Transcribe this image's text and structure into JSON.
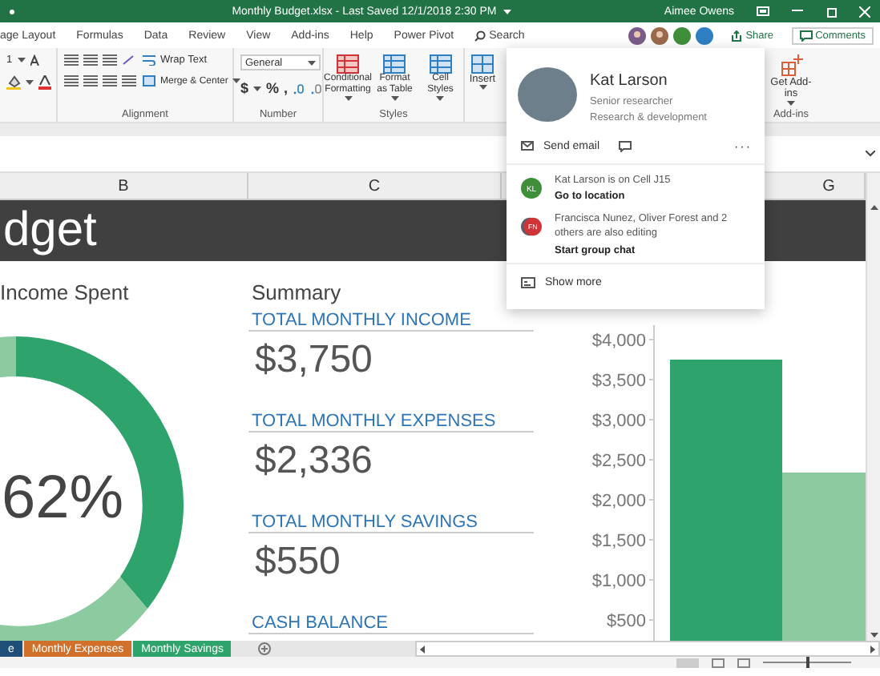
{
  "title_bar": {
    "title": "Monthly Budget.xlsx - Last Saved 12/1/2018 2:30 PM",
    "user": "Aimee Owens"
  },
  "ribbon_tabs": [
    "age Layout",
    "Formulas",
    "Data",
    "Review",
    "View",
    "Add-ins",
    "Help",
    "Power Pivot"
  ],
  "search": {
    "label": "Search"
  },
  "collaborators": [
    {
      "kind": "photo",
      "color": "#7a5c8a"
    },
    {
      "kind": "photo",
      "color": "#9a6a4a"
    },
    {
      "kind": "initials",
      "color": "#3f8f3a"
    },
    {
      "kind": "initials",
      "color": "#2f7fc4"
    }
  ],
  "share": "Share",
  "comments": "Comments",
  "ribbon": {
    "font_size": "1",
    "alignment": {
      "wrap_text": "Wrap Text",
      "merge_center": "Merge & Center",
      "label": "Alignment"
    },
    "number": {
      "format": "General",
      "currency": "$",
      "percent": "%",
      "comma": ",",
      "label": "Number"
    },
    "styles": {
      "buttons": [
        "Conditional Formatting",
        "Format as Table",
        "Cell Styles"
      ],
      "label": "Styles"
    },
    "cells": {
      "buttons": [
        "Insert"
      ]
    },
    "add_ins": {
      "button": "Get Add-ins",
      "label": "Add-ins"
    }
  },
  "column_headers": [
    {
      "label": "B"
    },
    {
      "label": "C"
    },
    {
      "label": "G"
    }
  ],
  "sheet": {
    "banner": "dget",
    "income_title": "Income Spent",
    "donut_label": "62%",
    "summary": {
      "title": "Summary",
      "items": [
        {
          "label": "TOTAL MONTHLY INCOME",
          "value": "$3,750"
        },
        {
          "label": "TOTAL MONTHLY EXPENSES",
          "value": "$2,336"
        },
        {
          "label": "TOTAL MONTHLY SAVINGS",
          "value": "$550"
        },
        {
          "label": "CASH BALANCE"
        }
      ]
    },
    "chart_axis_labels": [
      "$4,000",
      "$3,500",
      "$3,000",
      "$2,500",
      "$2,000",
      "$1,500",
      "$1,000",
      "$500"
    ]
  },
  "contact_card": {
    "name": "Kat Larson",
    "title": "Senior researcher",
    "department": "Research & development",
    "send_email": "Send email",
    "more": "···",
    "activity": [
      {
        "kind": "single",
        "initials": "KL",
        "color": "#3f8f3a",
        "text": "Kat Larson is on Cell J15",
        "action": "Go to location"
      },
      {
        "kind": "group",
        "initials": "FN",
        "color": "#d13438",
        "text": "Francisca Nunez, Oliver Forest and 2 others are also editing",
        "action": "Start group chat"
      }
    ],
    "show_more": "Show more"
  },
  "sheet_tabs": [
    {
      "label": "e",
      "color": "#1f4e79"
    },
    {
      "label": "Monthly Expenses",
      "color": "#d0702a"
    },
    {
      "label": "Monthly Savings",
      "color": "#2ea36b"
    }
  ],
  "zoom_slider": {
    "level": 0.5
  }
}
